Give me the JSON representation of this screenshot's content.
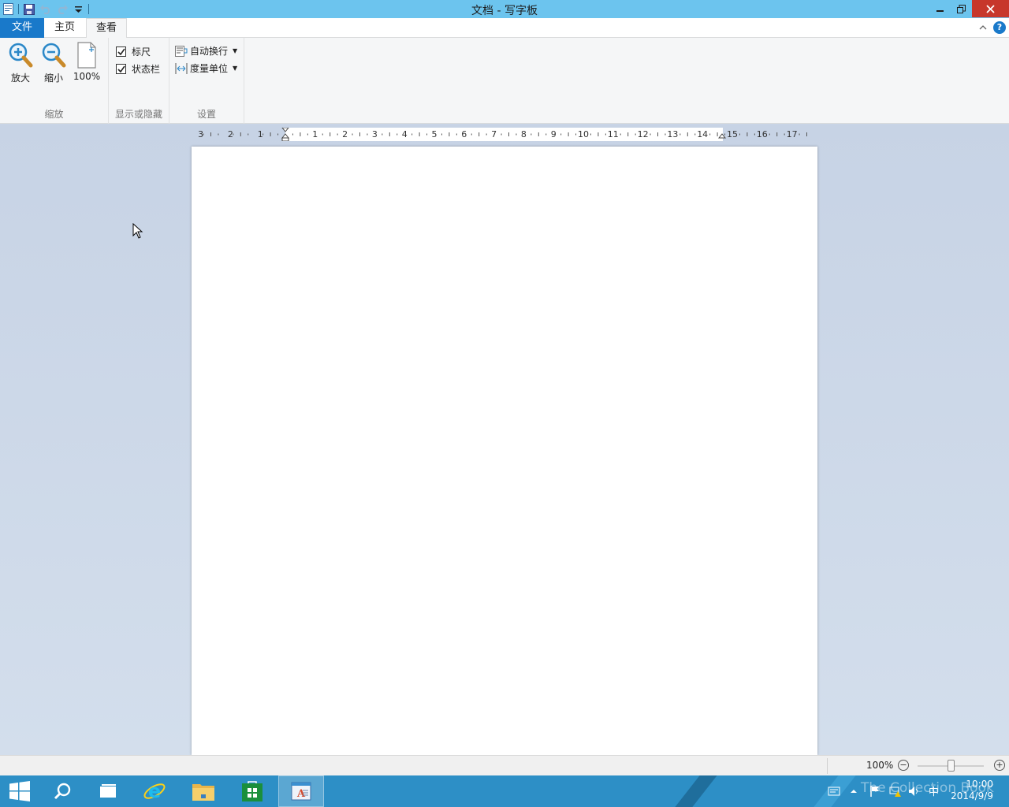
{
  "window": {
    "title": "文档 - 写字板"
  },
  "ribbon_tabs": {
    "file": "文件",
    "home": "主页",
    "view": "查看"
  },
  "ribbon": {
    "zoom_group": {
      "label": "缩放",
      "zoom_in": "放大",
      "zoom_out": "缩小",
      "hundred": "100%"
    },
    "show_hide_group": {
      "label": "显示或隐藏",
      "ruler": "标尺",
      "ruler_checked": true,
      "statusbar": "状态栏",
      "statusbar_checked": true
    },
    "settings_group": {
      "label": "设置",
      "word_wrap": "自动换行",
      "measurement_units": "度量单位"
    }
  },
  "ruler": {
    "left_labels": [
      "3",
      "2",
      "1"
    ],
    "right_labels": [
      "1",
      "2",
      "3",
      "4",
      "5",
      "6",
      "7",
      "8",
      "9",
      "10",
      "11",
      "12",
      "13",
      "14",
      "15",
      "16",
      "17"
    ]
  },
  "statusbar": {
    "zoom": "100%",
    "zoom_out_symbol": "−",
    "zoom_in_symbol": "+"
  },
  "taskbar": {
    "clock_time": "10:00",
    "clock_date": "2014/9/9",
    "ime": "中",
    "watermark": "The Collection Book"
  },
  "colors": {
    "titlebar": "#6cc4ee",
    "file_tab": "#1979ca",
    "taskbar": "#2d8fc6",
    "close_button": "#c7372b"
  },
  "icons": [
    "wordpad-app-icon",
    "save-icon",
    "undo-icon",
    "redo-icon",
    "customize-qat-icon",
    "minimize-icon",
    "restore-icon",
    "close-icon",
    "ribbon-collapse-icon",
    "help-icon",
    "zoom-in-icon",
    "zoom-out-icon",
    "page-100-icon",
    "word-wrap-icon",
    "measurement-units-icon",
    "windows-start-icon",
    "search-icon",
    "task-view-icon",
    "internet-explorer-icon",
    "file-explorer-icon",
    "store-icon",
    "wordpad-taskbar-icon"
  ]
}
